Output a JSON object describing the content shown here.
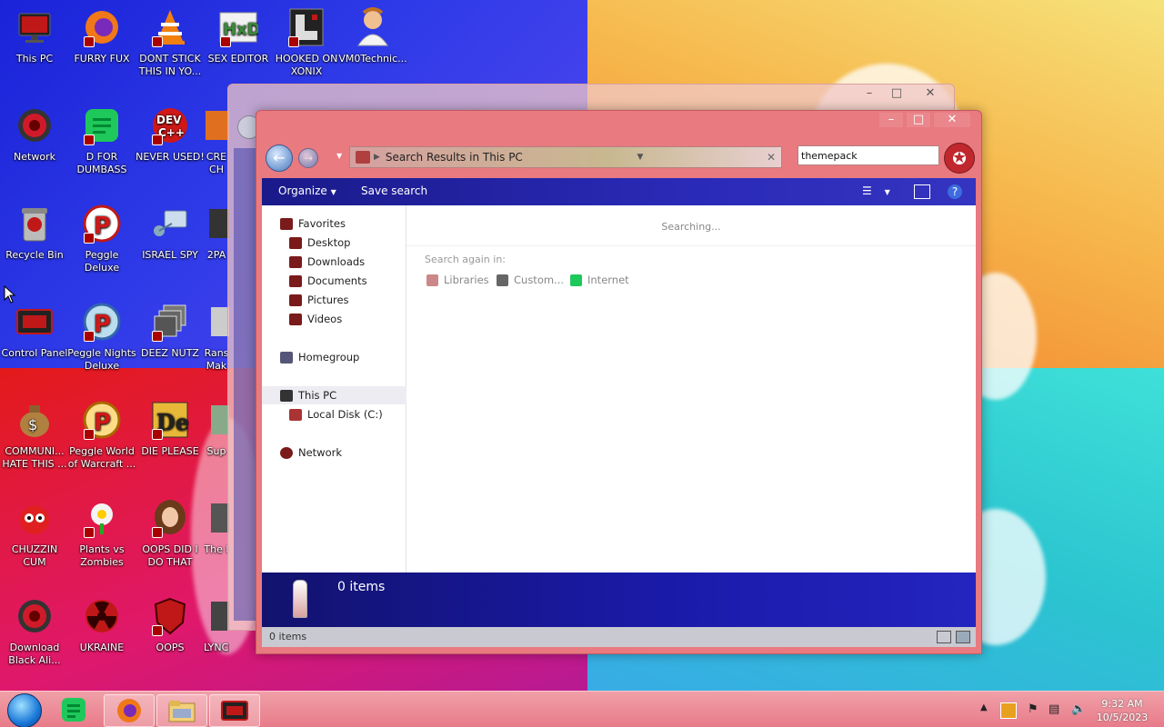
{
  "desktop": {
    "icons": [
      {
        "label": "This PC",
        "icon": "monitor-icon"
      },
      {
        "label": "FURRY FUX",
        "icon": "firefox-icon"
      },
      {
        "label": "DONT STICK\nTHIS IN YO...",
        "icon": "vlc-cone-icon"
      },
      {
        "label": "SEX EDITOR",
        "icon": "hxd-icon"
      },
      {
        "label": "HOOKED ON\nXONIX",
        "icon": "game-icon"
      },
      {
        "label": "VM0Technic...",
        "icon": "doctor-icon"
      },
      {
        "label": "Network",
        "icon": "network-globe-icon"
      },
      {
        "label": "D FOR\nDUMBASS",
        "icon": "green-app-icon"
      },
      {
        "label": "NEVER USED!",
        "icon": "devcpp-icon"
      },
      {
        "label": "CRE\nCH",
        "icon": "app-icon"
      },
      {
        "label": "Recycle Bin",
        "icon": "recycle-bin-icon"
      },
      {
        "label": "Peggle Deluxe",
        "icon": "peggle-icon"
      },
      {
        "label": "ISRAEL SPY",
        "icon": "spy-network-icon"
      },
      {
        "label": "2PA",
        "icon": "app-icon"
      },
      {
        "label": "Control Panel",
        "icon": "control-panel-icon"
      },
      {
        "label": "Peggle Nights\nDeluxe",
        "icon": "peggle-nights-icon"
      },
      {
        "label": "DEEZ NUTZ",
        "icon": "stacked-windows-icon"
      },
      {
        "label": "Rans\nMak",
        "icon": "app-icon"
      },
      {
        "label": "COMMUNI...\nHATE THIS ...",
        "icon": "money-bag-icon"
      },
      {
        "label": "Peggle World\nof Warcraft ...",
        "icon": "peggle-wow-icon"
      },
      {
        "label": "DIE PLEASE",
        "icon": "die-icon"
      },
      {
        "label": "Sup",
        "icon": "app-icon"
      },
      {
        "label": "CHUZZIN\nCUM",
        "icon": "chuzzle-icon"
      },
      {
        "label": "Plants vs\nZombies",
        "icon": "pvz-icon"
      },
      {
        "label": "OOPS DID I\nDO THAT",
        "icon": "portrait-icon"
      },
      {
        "label": "The I",
        "icon": "app-icon"
      },
      {
        "label": "Download\nBlack Ali...",
        "icon": "network-globe-icon"
      },
      {
        "label": "UKRAINE",
        "icon": "radiation-icon"
      },
      {
        "label": "OOPS",
        "icon": "shield-icon"
      },
      {
        "label": "LYNCHIN",
        "icon": "app-icon"
      }
    ]
  },
  "explorer": {
    "address": "Search Results in This PC",
    "search_value": "themepack",
    "toolbar": {
      "organize": "Organize",
      "save_search": "Save search"
    },
    "nav": {
      "favorites": "Favorites",
      "desktop": "Desktop",
      "downloads": "Downloads",
      "documents": "Documents",
      "pictures": "Pictures",
      "videos": "Videos",
      "homegroup": "Homegroup",
      "this_pc": "This PC",
      "local_disk": "Local Disk (C:)",
      "network": "Network"
    },
    "content": {
      "status": "Searching...",
      "search_again": "Search again in:",
      "locations": [
        "Libraries",
        "Custom...",
        "Internet"
      ]
    },
    "details_count": "0 items",
    "status_count": "0 items"
  },
  "taskbar": {
    "time": "9:32 AM",
    "date": "10/5/2023"
  },
  "colors": {
    "window_frame": "#e87a80",
    "toolbar": "#1a1a8a",
    "taskbar": "#e87a88"
  }
}
